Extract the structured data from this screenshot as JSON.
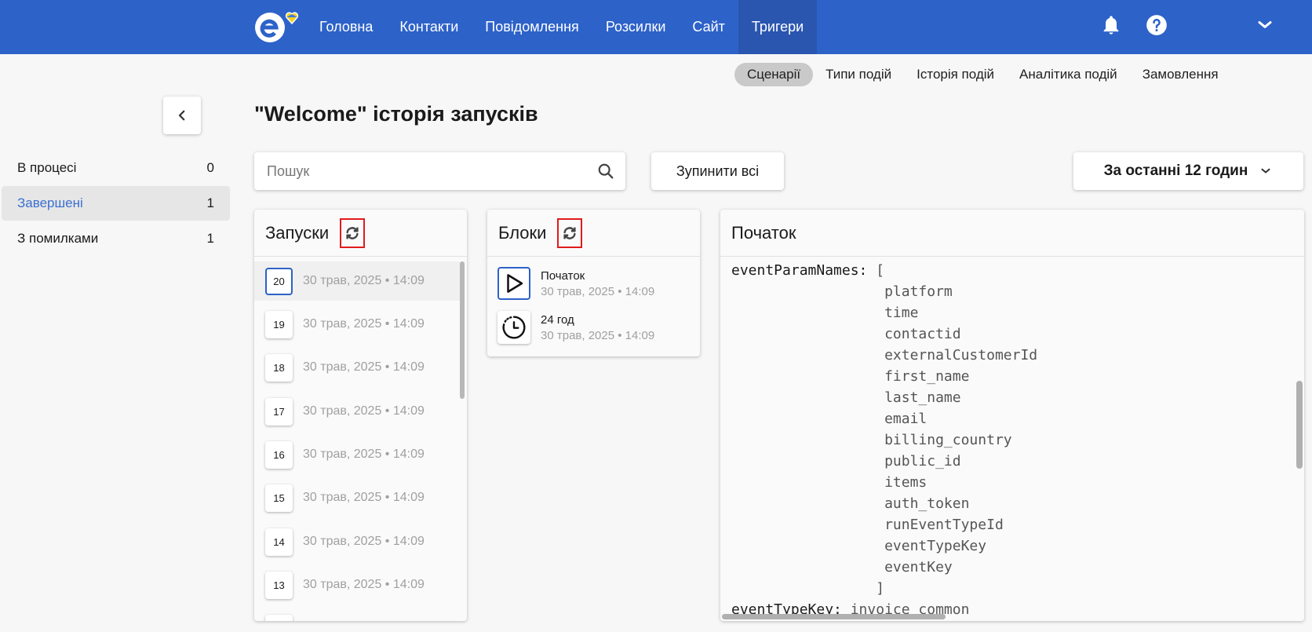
{
  "nav": {
    "items": [
      "Головна",
      "Контакти",
      "Повідомлення",
      "Розсилки",
      "Сайт",
      "Тригери"
    ],
    "active": "Тригери"
  },
  "subnav": {
    "items": [
      "Сценарії",
      "Типи подій",
      "Історія подій",
      "Аналітика подій",
      "Замовлення"
    ],
    "active": "Сценарії"
  },
  "sidebar": {
    "items": [
      {
        "label": "В процесі",
        "count": "0"
      },
      {
        "label": "Завершені",
        "count": "1"
      },
      {
        "label": "З помилками",
        "count": "1"
      }
    ],
    "active": "Завершені"
  },
  "page_title": "\"Welcome\" історія запусків",
  "search": {
    "placeholder": "Пошук",
    "value": ""
  },
  "stop_all_label": "Зупинити всі",
  "period_label": "За останні 12 годин",
  "runs_panel": {
    "title": "Запуски",
    "items": [
      {
        "num": "20",
        "date": "30 трав, 2025 • 14:09"
      },
      {
        "num": "19",
        "date": "30 трав, 2025 • 14:09"
      },
      {
        "num": "18",
        "date": "30 трав, 2025 • 14:09"
      },
      {
        "num": "17",
        "date": "30 трав, 2025 • 14:09"
      },
      {
        "num": "16",
        "date": "30 трав, 2025 • 14:09"
      },
      {
        "num": "15",
        "date": "30 трав, 2025 • 14:09"
      },
      {
        "num": "14",
        "date": "30 трав, 2025 • 14:09"
      },
      {
        "num": "13",
        "date": "30 трав, 2025 • 14:09"
      }
    ]
  },
  "blocks_panel": {
    "title": "Блоки",
    "items": [
      {
        "name": "Початок",
        "date": "30 трав, 2025 • 14:09",
        "icon": "play-icon"
      },
      {
        "name": "24 год",
        "date": "30 трав, 2025 • 14:09",
        "icon": "timer-icon"
      }
    ]
  },
  "details_panel": {
    "title": "Початок",
    "code_lines": [
      {
        "key": "eventParamNames: ",
        "val": "["
      },
      {
        "key": "",
        "val": "                  platform"
      },
      {
        "key": "",
        "val": "                  time"
      },
      {
        "key": "",
        "val": "                  contactid"
      },
      {
        "key": "",
        "val": "                  externalCustomerId"
      },
      {
        "key": "",
        "val": "                  first_name"
      },
      {
        "key": "",
        "val": "                  last_name"
      },
      {
        "key": "",
        "val": "                  email"
      },
      {
        "key": "",
        "val": "                  billing_country"
      },
      {
        "key": "",
        "val": "                  public_id"
      },
      {
        "key": "",
        "val": "                  items"
      },
      {
        "key": "",
        "val": "                  auth_token"
      },
      {
        "key": "",
        "val": "                  runEventTypeId"
      },
      {
        "key": "",
        "val": "                  eventTypeKey"
      },
      {
        "key": "",
        "val": "                  eventKey"
      },
      {
        "key": "",
        "val": "                 ]"
      },
      {
        "key": "eventTypeKey: ",
        "val": "invoice_common"
      }
    ]
  },
  "colors": {
    "brand": "#2d62c9",
    "highlight": "#e01c1c"
  }
}
